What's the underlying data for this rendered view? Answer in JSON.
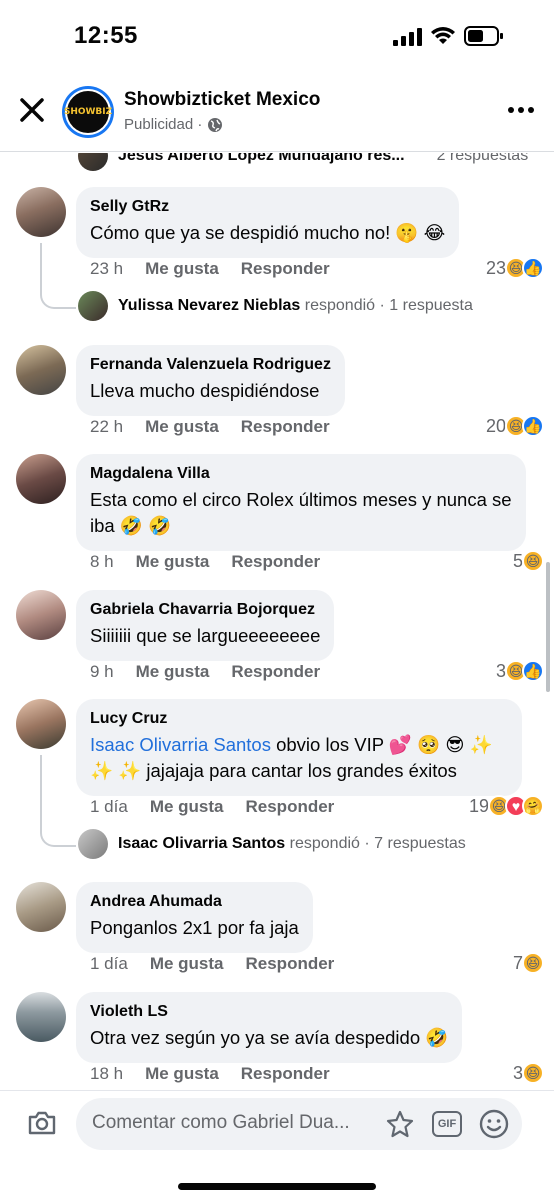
{
  "status": {
    "time": "12:55"
  },
  "header": {
    "page_name": "Showbizticket Mexico",
    "subtitle": "Publicidad ·",
    "logo_text": "SHOWBIZ"
  },
  "partial_top": {
    "name": "Jesús Alberto López Mundajano res...",
    "replies": "2 respuestas"
  },
  "comments": [
    {
      "name": "Selly GtRz",
      "text": "Cómo que ya se despidió mucho no! 🤫 😂",
      "ago": "23 h",
      "like": "Me gusta",
      "reply": "Responder",
      "count": "23",
      "reactions": [
        "haha",
        "like"
      ],
      "reply_row": {
        "name": "Yulissa Nevarez Nieblas",
        "action": "respondió",
        "count": "· 1 respuesta"
      }
    },
    {
      "name": "Fernanda Valenzuela Rodriguez",
      "text": "Lleva mucho despidiéndose",
      "ago": "22 h",
      "like": "Me gusta",
      "reply": "Responder",
      "count": "20",
      "reactions": [
        "haha",
        "like"
      ]
    },
    {
      "name": "Magdalena Villa",
      "text": "Esta como el circo Rolex últimos meses y nunca se iba 🤣 🤣",
      "ago": "8 h",
      "like": "Me gusta",
      "reply": "Responder",
      "count": "5",
      "reactions": [
        "haha"
      ]
    },
    {
      "name": "Gabriela Chavarria Bojorquez",
      "text": "Siiiiiii que se largueeeeeeee",
      "ago": "9 h",
      "like": "Me gusta",
      "reply": "Responder",
      "count": "3",
      "reactions": [
        "haha",
        "like"
      ]
    },
    {
      "name": "Lucy Cruz",
      "mention": "Isaac Olivarria Santos",
      "text": " obvio los VIP 💕 🥺 😎 ✨ ✨ ✨ jajajaja para cantar los grandes éxitos",
      "ago": "1 día",
      "like": "Me gusta",
      "reply": "Responder",
      "count": "19",
      "reactions": [
        "haha",
        "love",
        "care"
      ],
      "reply_row": {
        "name": "Isaac Olivarria Santos",
        "action": "respondió",
        "count": "· 7 respuestas"
      }
    },
    {
      "name": "Andrea Ahumada",
      "text": "Ponganlos 2x1 por fa jaja",
      "ago": "1 día",
      "like": "Me gusta",
      "reply": "Responder",
      "count": "7",
      "reactions": [
        "haha"
      ]
    },
    {
      "name": "Violeth LS",
      "text": "Otra vez según yo ya se avía despedido 🤣",
      "ago": "18 h",
      "like": "Me gusta",
      "reply": "Responder",
      "count": "3",
      "reactions": [
        "haha"
      ]
    }
  ],
  "composer": {
    "placeholder": "Comentar como Gabriel Dua...",
    "gif_label": "GIF"
  },
  "colors": {
    "accent": "#1877f2",
    "bubble": "#f0f2f5",
    "secondary_text": "#65676b"
  }
}
